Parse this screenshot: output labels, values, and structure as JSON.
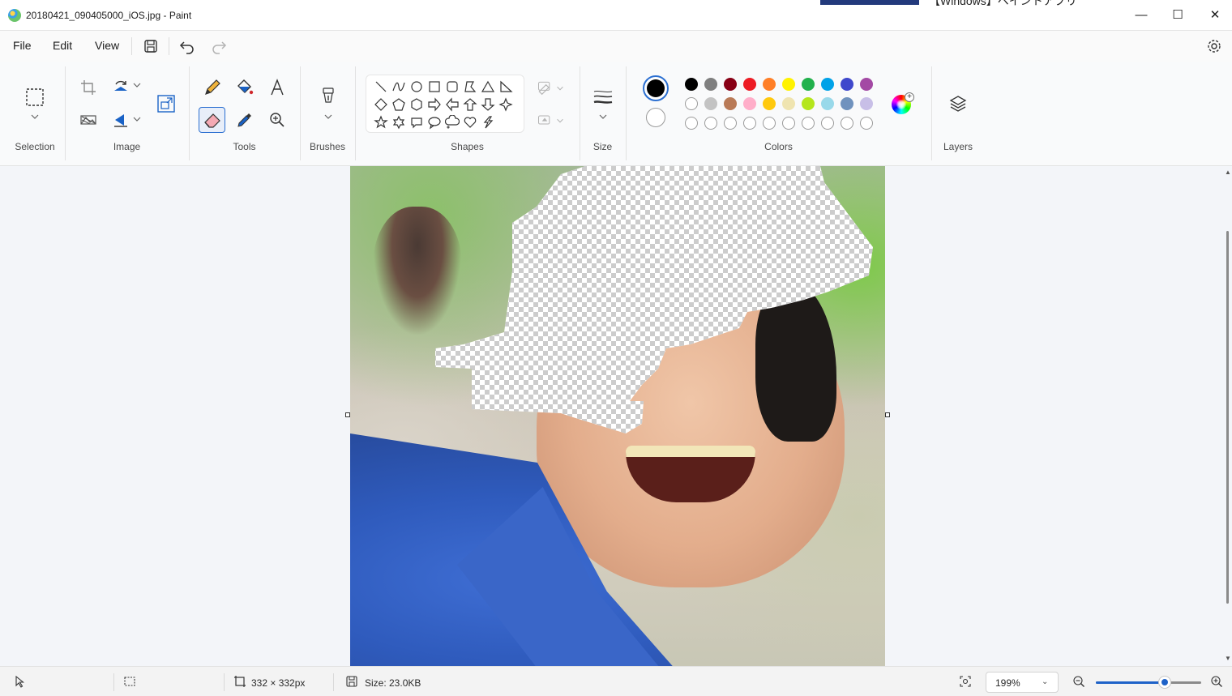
{
  "window": {
    "title": "20180421_090405000_iOS.jpg - Paint",
    "background_snippet": "【Windows】ペイントアプリ",
    "controls": {
      "minimize": "—",
      "maximize": "☐",
      "close": "✕"
    }
  },
  "menu": {
    "file": "File",
    "edit": "Edit",
    "view": "View",
    "icons": [
      "save-icon",
      "undo-icon",
      "redo-icon",
      "settings-gear-icon"
    ]
  },
  "ribbon": {
    "groups": {
      "selection": "Selection",
      "image": "Image",
      "tools": "Tools",
      "brushes": "Brushes",
      "shapes": "Shapes",
      "size": "Size",
      "colors": "Colors",
      "layers": "Layers"
    },
    "active_tool": "eraser",
    "color1": "#000000",
    "color2": "#ffffff",
    "palette_row1": [
      "#000000",
      "#7f7f7f",
      "#880015",
      "#ed1c24",
      "#ff7f27",
      "#fff200",
      "#22b14c",
      "#00a2e8",
      "#3f48cc",
      "#a349a4"
    ],
    "palette_row2": [
      "#ffffff",
      "#c3c3c3",
      "#b97a57",
      "#ffaec9",
      "#ffc90e",
      "#efe4b0",
      "#b5e61d",
      "#99d9ea",
      "#7092be",
      "#c8bfe7"
    ],
    "palette_row3_empty_count": 10
  },
  "status": {
    "dimensions": "332 × 332px",
    "size": "Size: 23.0KB",
    "zoom": "199%",
    "zoom_percent": 199
  }
}
